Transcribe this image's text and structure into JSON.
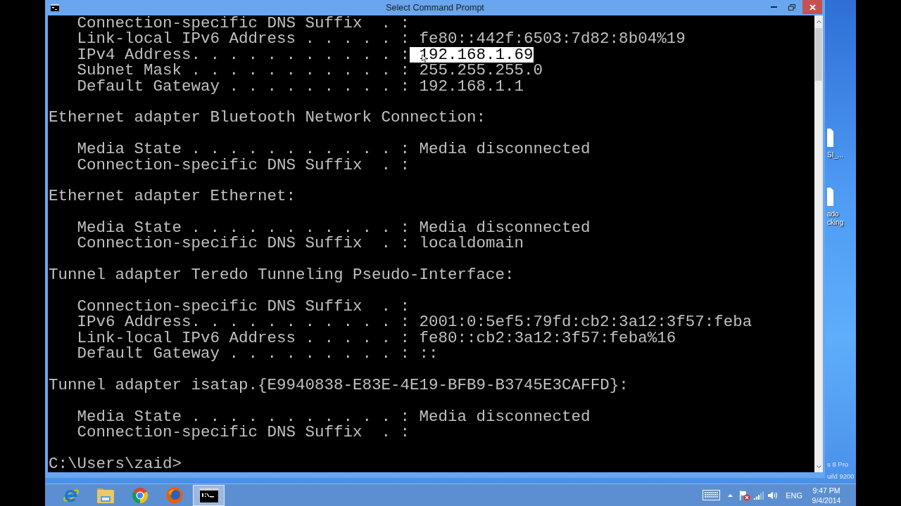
{
  "window": {
    "title": "Select Command Prompt"
  },
  "terminal": {
    "sections": [
      {
        "entries": [
          {
            "label": "Connection-specific DNS Suffix  . :",
            "selected": false
          },
          {
            "label": "Link-local IPv6 Address . . . . . :",
            "value": "fe80::442f:6503:7d82:8b04%19",
            "selected": false
          },
          {
            "label": "IPv4 Address. . . . . . . . . . . :",
            "value": "192.168.1.69",
            "selected": true
          },
          {
            "label": "Subnet Mask . . . . . . . . . . . :",
            "value": "255.255.255.0",
            "selected": false
          },
          {
            "label": "Default Gateway . . . . . . . . . :",
            "value": "192.168.1.1",
            "selected": false
          }
        ]
      },
      {
        "header": "Ethernet adapter Bluetooth Network Connection:",
        "entries": [
          {
            "label": "Media State . . . . . . . . . . . :",
            "value": "Media disconnected",
            "selected": false
          },
          {
            "label": "Connection-specific DNS Suffix  . :",
            "selected": false
          }
        ]
      },
      {
        "header": "Ethernet adapter Ethernet:",
        "entries": [
          {
            "label": "Media State . . . . . . . . . . . :",
            "value": "Media disconnected",
            "selected": false
          },
          {
            "label": "Connection-specific DNS Suffix  . :",
            "value": "localdomain",
            "selected": false
          }
        ]
      },
      {
        "header": "Tunnel adapter Teredo Tunneling Pseudo-Interface:",
        "entries": [
          {
            "label": "Connection-specific DNS Suffix  . :",
            "selected": false
          },
          {
            "label": "IPv6 Address. . . . . . . . . . . :",
            "value": "2001:0:5ef5:79fd:cb2:3a12:3f57:feba",
            "selected": false
          },
          {
            "label": "Link-local IPv6 Address . . . . . :",
            "value": "fe80::cb2:3a12:3f57:feba%16",
            "selected": false
          },
          {
            "label": "Default Gateway . . . . . . . . . :",
            "value": "::",
            "selected": false
          }
        ]
      },
      {
        "header": "Tunnel adapter isatap.{E9940838-E83E-4E19-BFB9-B3745E3CAFFD}:",
        "entries": [
          {
            "label": "Media State . . . . . . . . . . . :",
            "value": "Media disconnected",
            "selected": false
          },
          {
            "label": "Connection-specific DNS Suffix  . :",
            "selected": false
          }
        ]
      }
    ],
    "prompt": "C:\\Users\\zaid>"
  },
  "desktop": {
    "icons": [
      {
        "label_lines": [
          "SI_..."
        ]
      },
      {
        "label_lines": [
          "ado",
          "cking"
        ]
      }
    ],
    "edition_lines": [
      "s 8 Pro",
      "uild 9200"
    ]
  },
  "taskbar": {
    "apps": [
      {
        "selected": false
      },
      {
        "selected": false
      },
      {
        "selected": false
      },
      {
        "selected": false
      },
      {
        "selected": true
      }
    ],
    "tray": {
      "language": "ENG",
      "time": "9:47 PM",
      "date": "9/4/2014"
    }
  }
}
